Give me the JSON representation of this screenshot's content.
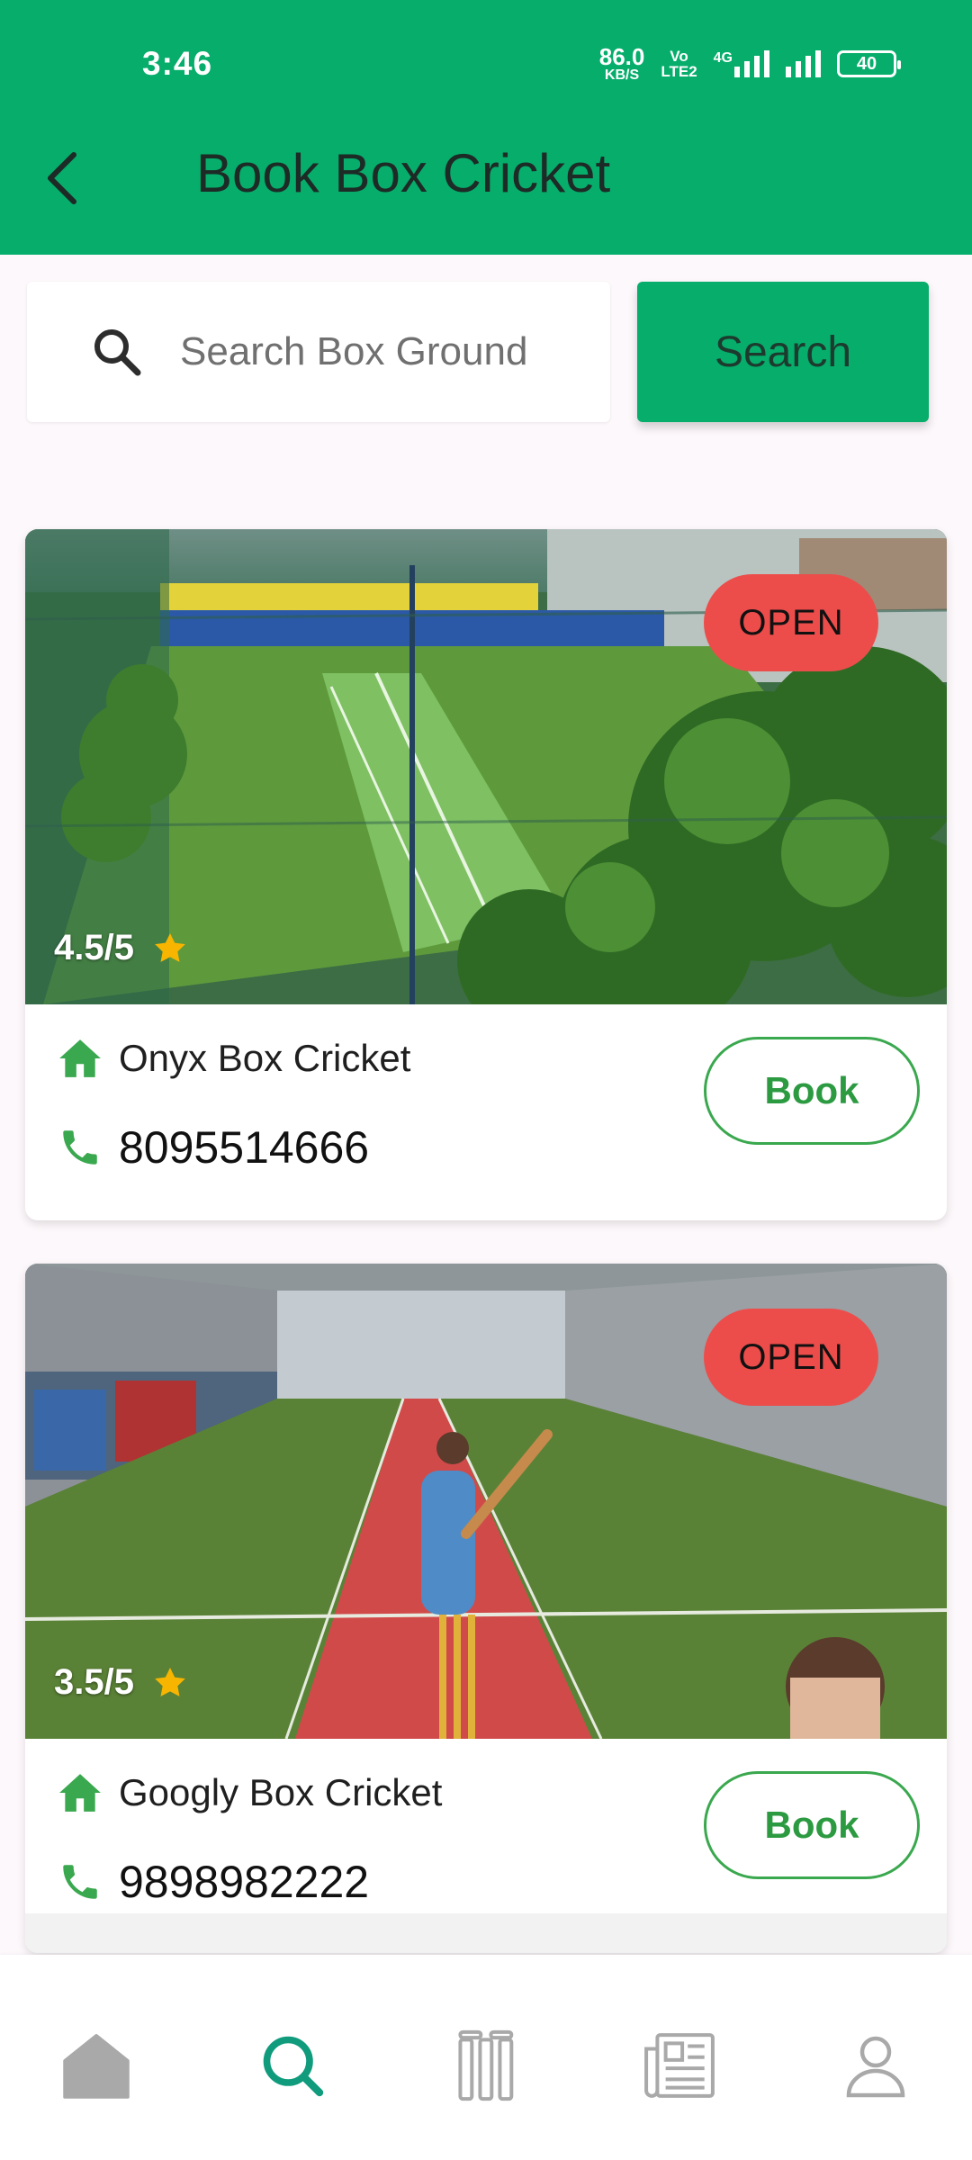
{
  "status_bar": {
    "time": "3:46",
    "net_speed_value": "86.0",
    "net_speed_unit": "KB/S",
    "volte_top": "Vo",
    "volte_bottom": "LTE2",
    "network_type": "4G",
    "battery": "40"
  },
  "header": {
    "back_icon": "back-arrow-icon",
    "title": "Book Box Cricket"
  },
  "search": {
    "placeholder": "Search Box Ground",
    "value": "",
    "button_label": "Search"
  },
  "grounds": [
    {
      "status": "OPEN",
      "rating": "4.5/5",
      "name": "Onyx Box Cricket",
      "phone": "8095514666",
      "book_label": "Book"
    },
    {
      "status": "OPEN",
      "rating": "3.5/5",
      "name": "Googly Box Cricket",
      "phone": "9898982222",
      "book_label": "Book"
    }
  ],
  "nav": {
    "items": [
      {
        "icon": "home-icon",
        "active": false
      },
      {
        "icon": "search-icon",
        "active": true
      },
      {
        "icon": "stumps-icon",
        "active": false
      },
      {
        "icon": "news-icon",
        "active": false
      },
      {
        "icon": "profile-icon",
        "active": false
      }
    ]
  },
  "colors": {
    "primary": "#06ad6b",
    "open_badge": "#ec4d4b",
    "book_button": "#3aa84e",
    "star": "#f7b500",
    "nav_active": "#0f9b7c",
    "nav_inactive": "#a9a9a9"
  }
}
